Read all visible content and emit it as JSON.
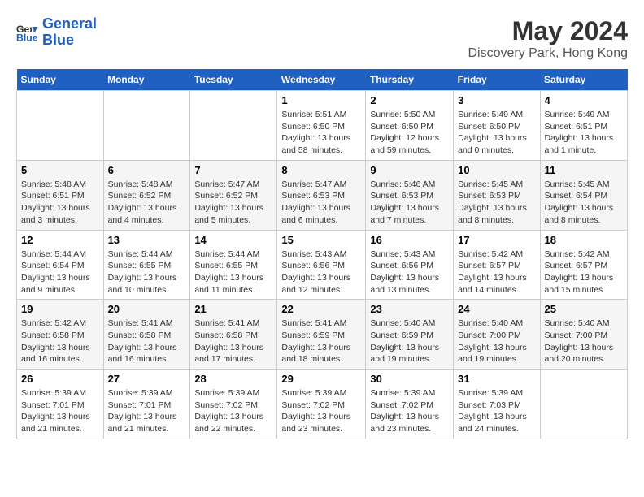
{
  "header": {
    "logo_line1": "General",
    "logo_line2": "Blue",
    "title": "May 2024",
    "subtitle": "Discovery Park, Hong Kong"
  },
  "days": [
    "Sunday",
    "Monday",
    "Tuesday",
    "Wednesday",
    "Thursday",
    "Friday",
    "Saturday"
  ],
  "weeks": [
    [
      {
        "date": "",
        "info": ""
      },
      {
        "date": "",
        "info": ""
      },
      {
        "date": "",
        "info": ""
      },
      {
        "date": "1",
        "info": "Sunrise: 5:51 AM\nSunset: 6:50 PM\nDaylight: 13 hours and 58 minutes."
      },
      {
        "date": "2",
        "info": "Sunrise: 5:50 AM\nSunset: 6:50 PM\nDaylight: 12 hours and 59 minutes."
      },
      {
        "date": "3",
        "info": "Sunrise: 5:49 AM\nSunset: 6:50 PM\nDaylight: 13 hours and 0 minutes."
      },
      {
        "date": "4",
        "info": "Sunrise: 5:49 AM\nSunset: 6:51 PM\nDaylight: 13 hours and 1 minute."
      }
    ],
    [
      {
        "date": "5",
        "info": "Sunrise: 5:48 AM\nSunset: 6:51 PM\nDaylight: 13 hours and 3 minutes."
      },
      {
        "date": "6",
        "info": "Sunrise: 5:48 AM\nSunset: 6:52 PM\nDaylight: 13 hours and 4 minutes."
      },
      {
        "date": "7",
        "info": "Sunrise: 5:47 AM\nSunset: 6:52 PM\nDaylight: 13 hours and 5 minutes."
      },
      {
        "date": "8",
        "info": "Sunrise: 5:47 AM\nSunset: 6:53 PM\nDaylight: 13 hours and 6 minutes."
      },
      {
        "date": "9",
        "info": "Sunrise: 5:46 AM\nSunset: 6:53 PM\nDaylight: 13 hours and 7 minutes."
      },
      {
        "date": "10",
        "info": "Sunrise: 5:45 AM\nSunset: 6:53 PM\nDaylight: 13 hours and 8 minutes."
      },
      {
        "date": "11",
        "info": "Sunrise: 5:45 AM\nSunset: 6:54 PM\nDaylight: 13 hours and 8 minutes."
      }
    ],
    [
      {
        "date": "12",
        "info": "Sunrise: 5:44 AM\nSunset: 6:54 PM\nDaylight: 13 hours and 9 minutes."
      },
      {
        "date": "13",
        "info": "Sunrise: 5:44 AM\nSunset: 6:55 PM\nDaylight: 13 hours and 10 minutes."
      },
      {
        "date": "14",
        "info": "Sunrise: 5:44 AM\nSunset: 6:55 PM\nDaylight: 13 hours and 11 minutes."
      },
      {
        "date": "15",
        "info": "Sunrise: 5:43 AM\nSunset: 6:56 PM\nDaylight: 13 hours and 12 minutes."
      },
      {
        "date": "16",
        "info": "Sunrise: 5:43 AM\nSunset: 6:56 PM\nDaylight: 13 hours and 13 minutes."
      },
      {
        "date": "17",
        "info": "Sunrise: 5:42 AM\nSunset: 6:57 PM\nDaylight: 13 hours and 14 minutes."
      },
      {
        "date": "18",
        "info": "Sunrise: 5:42 AM\nSunset: 6:57 PM\nDaylight: 13 hours and 15 minutes."
      }
    ],
    [
      {
        "date": "19",
        "info": "Sunrise: 5:42 AM\nSunset: 6:58 PM\nDaylight: 13 hours and 16 minutes."
      },
      {
        "date": "20",
        "info": "Sunrise: 5:41 AM\nSunset: 6:58 PM\nDaylight: 13 hours and 16 minutes."
      },
      {
        "date": "21",
        "info": "Sunrise: 5:41 AM\nSunset: 6:58 PM\nDaylight: 13 hours and 17 minutes."
      },
      {
        "date": "22",
        "info": "Sunrise: 5:41 AM\nSunset: 6:59 PM\nDaylight: 13 hours and 18 minutes."
      },
      {
        "date": "23",
        "info": "Sunrise: 5:40 AM\nSunset: 6:59 PM\nDaylight: 13 hours and 19 minutes."
      },
      {
        "date": "24",
        "info": "Sunrise: 5:40 AM\nSunset: 7:00 PM\nDaylight: 13 hours and 19 minutes."
      },
      {
        "date": "25",
        "info": "Sunrise: 5:40 AM\nSunset: 7:00 PM\nDaylight: 13 hours and 20 minutes."
      }
    ],
    [
      {
        "date": "26",
        "info": "Sunrise: 5:39 AM\nSunset: 7:01 PM\nDaylight: 13 hours and 21 minutes."
      },
      {
        "date": "27",
        "info": "Sunrise: 5:39 AM\nSunset: 7:01 PM\nDaylight: 13 hours and 21 minutes."
      },
      {
        "date": "28",
        "info": "Sunrise: 5:39 AM\nSunset: 7:02 PM\nDaylight: 13 hours and 22 minutes."
      },
      {
        "date": "29",
        "info": "Sunrise: 5:39 AM\nSunset: 7:02 PM\nDaylight: 13 hours and 23 minutes."
      },
      {
        "date": "30",
        "info": "Sunrise: 5:39 AM\nSunset: 7:02 PM\nDaylight: 13 hours and 23 minutes."
      },
      {
        "date": "31",
        "info": "Sunrise: 5:39 AM\nSunset: 7:03 PM\nDaylight: 13 hours and 24 minutes."
      },
      {
        "date": "",
        "info": ""
      }
    ]
  ]
}
